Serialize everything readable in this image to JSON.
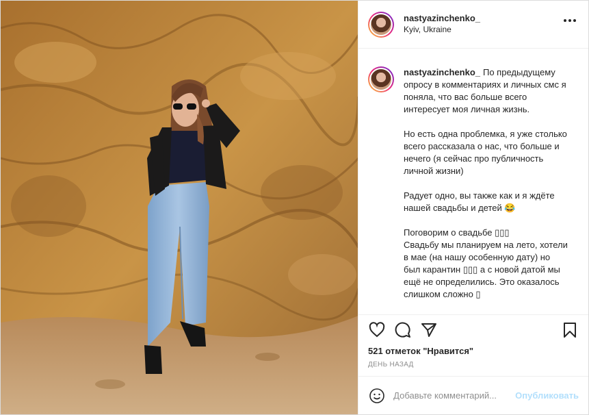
{
  "post": {
    "author": {
      "username": "nastyazinchenko_",
      "location": "Kyiv, Ukraine"
    },
    "photo": {
      "description_icon": "photo",
      "colors": {
        "rock": "#b9813a",
        "rock_dark": "#7d4f1d",
        "jeans": "#8fb2d6",
        "jacket": "#1b1a1a",
        "sand": "#c49a6a"
      }
    },
    "caption": {
      "username": "nastyazinchenko_",
      "paragraphs": [
        "По предыдущему опросу в комментариях и личных смс я поняла, что вас больше всего интересует моя личная жизнь.",
        "Но есть одна проблемка, я уже столько всего рассказала о нас, что больше и нечего (я сейчас про публичность личной жизни)",
        "Радует одно, вы также как и я ждёте нашей свадьбы и детей 😂",
        "Поговорим о свадьбе ▯▯▯\nСвадьбу мы планируем на лето, хотели в мае (на нашу особенную дату) но был карантин ▯▯▯ а с новой датой мы ещё не определились. Это оказалось слишком сложно ▯"
      ]
    },
    "actions": {
      "like_icon": "heart-icon",
      "comment_icon": "comment-icon",
      "share_icon": "share-icon",
      "save_icon": "bookmark-icon"
    },
    "likes_text": "521 отметок \"Нравится\"",
    "time_text": "ДЕНЬ НАЗАД",
    "comment_form": {
      "placeholder": "Добавьте комментарий...",
      "post_label": "Опубликовать"
    },
    "colors": {
      "post_button": "#b2dffc",
      "border": "#dbdbdb",
      "secondary_text": "#8e8e8e"
    }
  }
}
